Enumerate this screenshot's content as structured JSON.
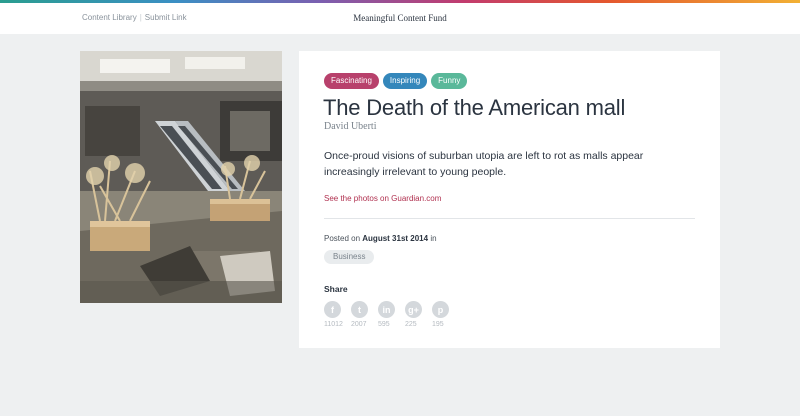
{
  "nav": {
    "content_library": "Content Library",
    "separator": "|",
    "submit_link": "Submit Link"
  },
  "brand": "Meaningful Content Fund",
  "article": {
    "tags": [
      {
        "label": "Fascinating",
        "color": "#b8416c"
      },
      {
        "label": "Inspiring",
        "color": "#3487bb"
      },
      {
        "label": "Funny",
        "color": "#5ab89a"
      }
    ],
    "title": "The Death of the American mall",
    "author": "David Uberti",
    "description": "Once-proud visions of suburban utopia are left to rot as malls appear increasingly irrelevant to young people.",
    "source_link": "See the photos on Guardian.com",
    "posted_prefix": "Posted on",
    "posted_date": "August 31st 2014",
    "posted_suffix": "in",
    "category": "Business"
  },
  "share": {
    "label": "Share",
    "items": [
      {
        "name": "facebook",
        "icon": "facebook-icon",
        "glyph": "f",
        "count": "11012"
      },
      {
        "name": "twitter",
        "icon": "twitter-icon",
        "glyph": "t",
        "count": "2007"
      },
      {
        "name": "linkedin",
        "icon": "linkedin-icon",
        "glyph": "in",
        "count": "595"
      },
      {
        "name": "google-plus",
        "icon": "google-plus-icon",
        "glyph": "g+",
        "count": "225"
      },
      {
        "name": "pinterest",
        "icon": "pinterest-icon",
        "glyph": "p",
        "count": "195"
      }
    ]
  }
}
